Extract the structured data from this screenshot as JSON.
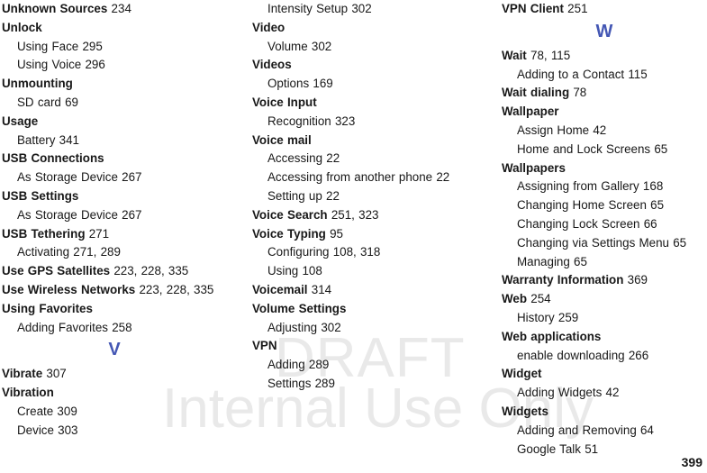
{
  "document": {
    "page_number": "399",
    "accent_color": "#4457b4",
    "watermark_color": "#e9e9e9"
  },
  "watermark": {
    "line1": "DRAFT",
    "line2": "Internal Use Only"
  },
  "columns": [
    {
      "name": "column-1",
      "blocks": [
        {
          "kind": "entry",
          "level": 0,
          "term": "Unknown Sources",
          "pages": "234"
        },
        {
          "kind": "entry",
          "level": 0,
          "term": "Unlock",
          "pages": ""
        },
        {
          "kind": "entry",
          "level": 1,
          "term": "Using Face",
          "pages": "295"
        },
        {
          "kind": "entry",
          "level": 1,
          "term": "Using Voice",
          "pages": "296"
        },
        {
          "kind": "entry",
          "level": 0,
          "term": "Unmounting",
          "pages": ""
        },
        {
          "kind": "entry",
          "level": 1,
          "term": "SD card",
          "pages": "69"
        },
        {
          "kind": "entry",
          "level": 0,
          "term": "Usage",
          "pages": ""
        },
        {
          "kind": "entry",
          "level": 1,
          "term": "Battery",
          "pages": "341"
        },
        {
          "kind": "entry",
          "level": 0,
          "term": "USB Connections",
          "pages": ""
        },
        {
          "kind": "entry",
          "level": 1,
          "term": "As Storage Device",
          "pages": "267"
        },
        {
          "kind": "entry",
          "level": 0,
          "term": "USB Settings",
          "pages": ""
        },
        {
          "kind": "entry",
          "level": 1,
          "term": "As Storage Device",
          "pages": "267"
        },
        {
          "kind": "entry",
          "level": 0,
          "term": "USB Tethering",
          "pages": "271"
        },
        {
          "kind": "entry",
          "level": 1,
          "term": "Activating",
          "pages": "271, 289"
        },
        {
          "kind": "entry",
          "level": 0,
          "term": "Use GPS Satellites",
          "pages": "223, 228, 335"
        },
        {
          "kind": "entry",
          "level": 0,
          "term": "Use Wireless Networks",
          "pages": "223, 228, 335"
        },
        {
          "kind": "entry",
          "level": 0,
          "term": "Using Favorites",
          "pages": ""
        },
        {
          "kind": "entry",
          "level": 1,
          "term": "Adding Favorites",
          "pages": "258"
        },
        {
          "kind": "letter",
          "letter": "V"
        },
        {
          "kind": "entry",
          "level": 0,
          "term": "Vibrate",
          "pages": "307"
        },
        {
          "kind": "entry",
          "level": 0,
          "term": "Vibration",
          "pages": ""
        },
        {
          "kind": "entry",
          "level": 1,
          "term": "Create",
          "pages": "309"
        },
        {
          "kind": "entry",
          "level": 1,
          "term": "Device",
          "pages": "303"
        }
      ]
    },
    {
      "name": "column-2",
      "blocks": [
        {
          "kind": "entry",
          "level": 1,
          "term": "Intensity Setup",
          "pages": "302"
        },
        {
          "kind": "entry",
          "level": 0,
          "term": "Video",
          "pages": ""
        },
        {
          "kind": "entry",
          "level": 1,
          "term": "Volume",
          "pages": "302"
        },
        {
          "kind": "entry",
          "level": 0,
          "term": "Videos",
          "pages": ""
        },
        {
          "kind": "entry",
          "level": 1,
          "term": "Options",
          "pages": "169"
        },
        {
          "kind": "entry",
          "level": 0,
          "term": "Voice Input",
          "pages": ""
        },
        {
          "kind": "entry",
          "level": 1,
          "term": "Recognition",
          "pages": "323"
        },
        {
          "kind": "entry",
          "level": 0,
          "term": "Voice mail",
          "pages": ""
        },
        {
          "kind": "entry",
          "level": 1,
          "term": "Accessing",
          "pages": "22"
        },
        {
          "kind": "entry",
          "level": 1,
          "term": "Accessing from another phone",
          "pages": "22"
        },
        {
          "kind": "entry",
          "level": 1,
          "term": "Setting up",
          "pages": "22"
        },
        {
          "kind": "entry",
          "level": 0,
          "term": "Voice Search",
          "pages": "251, 323"
        },
        {
          "kind": "entry",
          "level": 0,
          "term": "Voice Typing",
          "pages": "95"
        },
        {
          "kind": "entry",
          "level": 1,
          "term": "Configuring",
          "pages": "108, 318"
        },
        {
          "kind": "entry",
          "level": 1,
          "term": "Using",
          "pages": "108"
        },
        {
          "kind": "entry",
          "level": 0,
          "term": "Voicemail",
          "pages": "314"
        },
        {
          "kind": "entry",
          "level": 0,
          "term": "Volume Settings",
          "pages": ""
        },
        {
          "kind": "entry",
          "level": 1,
          "term": "Adjusting",
          "pages": "302"
        },
        {
          "kind": "entry",
          "level": 0,
          "term": "VPN",
          "pages": ""
        },
        {
          "kind": "entry",
          "level": 1,
          "term": "Adding",
          "pages": "289"
        },
        {
          "kind": "entry",
          "level": 1,
          "term": "Settings",
          "pages": "289"
        }
      ]
    },
    {
      "name": "column-3",
      "blocks": [
        {
          "kind": "entry",
          "level": 0,
          "term": "VPN Client",
          "pages": "251"
        },
        {
          "kind": "letter",
          "letter": "W"
        },
        {
          "kind": "entry",
          "level": 0,
          "term": "Wait",
          "pages": "78, 115"
        },
        {
          "kind": "entry",
          "level": 1,
          "term": "Adding to a Contact",
          "pages": "115"
        },
        {
          "kind": "entry",
          "level": 0,
          "term": "Wait dialing",
          "pages": "78"
        },
        {
          "kind": "entry",
          "level": 0,
          "term": "Wallpaper",
          "pages": ""
        },
        {
          "kind": "entry",
          "level": 1,
          "term": "Assign Home",
          "pages": "42"
        },
        {
          "kind": "entry",
          "level": 1,
          "term": "Home and Lock Screens",
          "pages": "65"
        },
        {
          "kind": "entry",
          "level": 0,
          "term": "Wallpapers",
          "pages": ""
        },
        {
          "kind": "entry",
          "level": 1,
          "term": "Assigning from Gallery",
          "pages": "168"
        },
        {
          "kind": "entry",
          "level": 1,
          "term": "Changing Home Screen",
          "pages": "65"
        },
        {
          "kind": "entry",
          "level": 1,
          "term": "Changing Lock Screen",
          "pages": "66"
        },
        {
          "kind": "entry",
          "level": 1,
          "term": "Changing via Settings Menu",
          "pages": "65"
        },
        {
          "kind": "entry",
          "level": 1,
          "term": "Managing",
          "pages": "65"
        },
        {
          "kind": "entry",
          "level": 0,
          "term": "Warranty Information",
          "pages": "369"
        },
        {
          "kind": "entry",
          "level": 0,
          "term": "Web",
          "pages": "254"
        },
        {
          "kind": "entry",
          "level": 1,
          "term": "History",
          "pages": "259"
        },
        {
          "kind": "entry",
          "level": 0,
          "term": "Web applications",
          "pages": ""
        },
        {
          "kind": "entry",
          "level": 1,
          "term": "enable downloading",
          "pages": "266"
        },
        {
          "kind": "entry",
          "level": 0,
          "term": "Widget",
          "pages": ""
        },
        {
          "kind": "entry",
          "level": 1,
          "term": "Adding Widgets",
          "pages": "42"
        },
        {
          "kind": "entry",
          "level": 0,
          "term": "Widgets",
          "pages": ""
        },
        {
          "kind": "entry",
          "level": 1,
          "term": "Adding and Removing",
          "pages": "64"
        },
        {
          "kind": "entry",
          "level": 1,
          "term": "Google Talk",
          "pages": "51"
        }
      ]
    }
  ]
}
